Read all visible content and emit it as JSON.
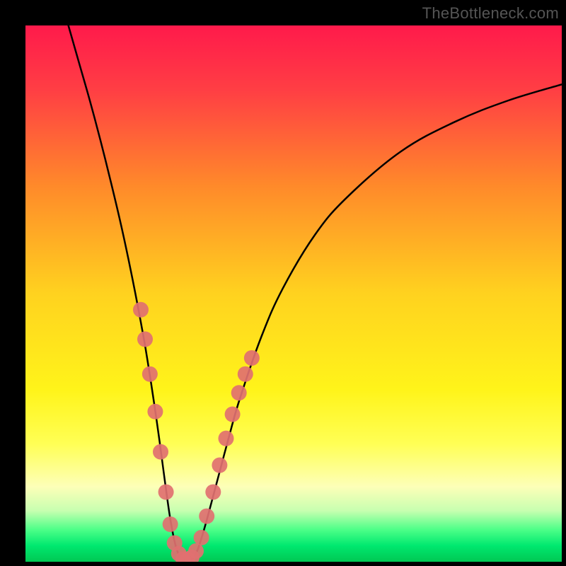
{
  "watermark": "TheBottleneck.com",
  "chart_data": {
    "type": "line",
    "title": "",
    "xlabel": "",
    "ylabel": "",
    "xlim": [
      0,
      100
    ],
    "ylim": [
      0,
      100
    ],
    "annotations": [],
    "background_gradient": {
      "stops": [
        {
          "offset": 0.0,
          "color": "#ff1a4b"
        },
        {
          "offset": 0.12,
          "color": "#ff3e44"
        },
        {
          "offset": 0.3,
          "color": "#ff8a2a"
        },
        {
          "offset": 0.5,
          "color": "#ffd21f"
        },
        {
          "offset": 0.68,
          "color": "#fff41a"
        },
        {
          "offset": 0.78,
          "color": "#ffff55"
        },
        {
          "offset": 0.86,
          "color": "#fdffb8"
        },
        {
          "offset": 0.905,
          "color": "#c7ffb0"
        },
        {
          "offset": 0.94,
          "color": "#4dff88"
        },
        {
          "offset": 0.97,
          "color": "#00e86f"
        },
        {
          "offset": 1.0,
          "color": "#00c853"
        }
      ]
    },
    "series": [
      {
        "name": "bottleneck-curve",
        "color": "#000000",
        "width": 2.5,
        "x": [
          8,
          10,
          12,
          14,
          16,
          18,
          20,
          22,
          23,
          24,
          25,
          26,
          27,
          28,
          29,
          30,
          31,
          32,
          33,
          34,
          36,
          38,
          40,
          44,
          48,
          54,
          60,
          70,
          80,
          90,
          100
        ],
        "y": [
          100,
          93,
          86,
          78.5,
          70.5,
          62,
          52.5,
          42,
          36,
          29.5,
          22.5,
          15,
          8,
          3,
          0.5,
          0,
          0.5,
          2,
          5,
          8.5,
          16,
          23.5,
          30.5,
          42,
          51,
          61,
          68,
          76.5,
          82,
          86,
          89
        ]
      },
      {
        "name": "highlight-dots-left",
        "color": "#e17070",
        "type": "scatter",
        "radius": 11,
        "x": [
          21.5,
          22.3,
          23.2,
          24.2,
          25.2,
          26.2,
          27.0,
          27.8,
          28.6,
          29.4
        ],
        "y": [
          47,
          41.5,
          35,
          28,
          20.5,
          13,
          7,
          3.5,
          1.5,
          0.5
        ]
      },
      {
        "name": "highlight-dots-right",
        "color": "#e17070",
        "type": "scatter",
        "radius": 11,
        "x": [
          30.2,
          31.0,
          31.8,
          32.8,
          33.8,
          35.0,
          36.2,
          37.4,
          38.6,
          39.8,
          41.0,
          42.2
        ],
        "y": [
          0.4,
          0.8,
          2.0,
          4.5,
          8.5,
          13,
          18,
          23,
          27.5,
          31.5,
          35,
          38
        ]
      }
    ]
  }
}
